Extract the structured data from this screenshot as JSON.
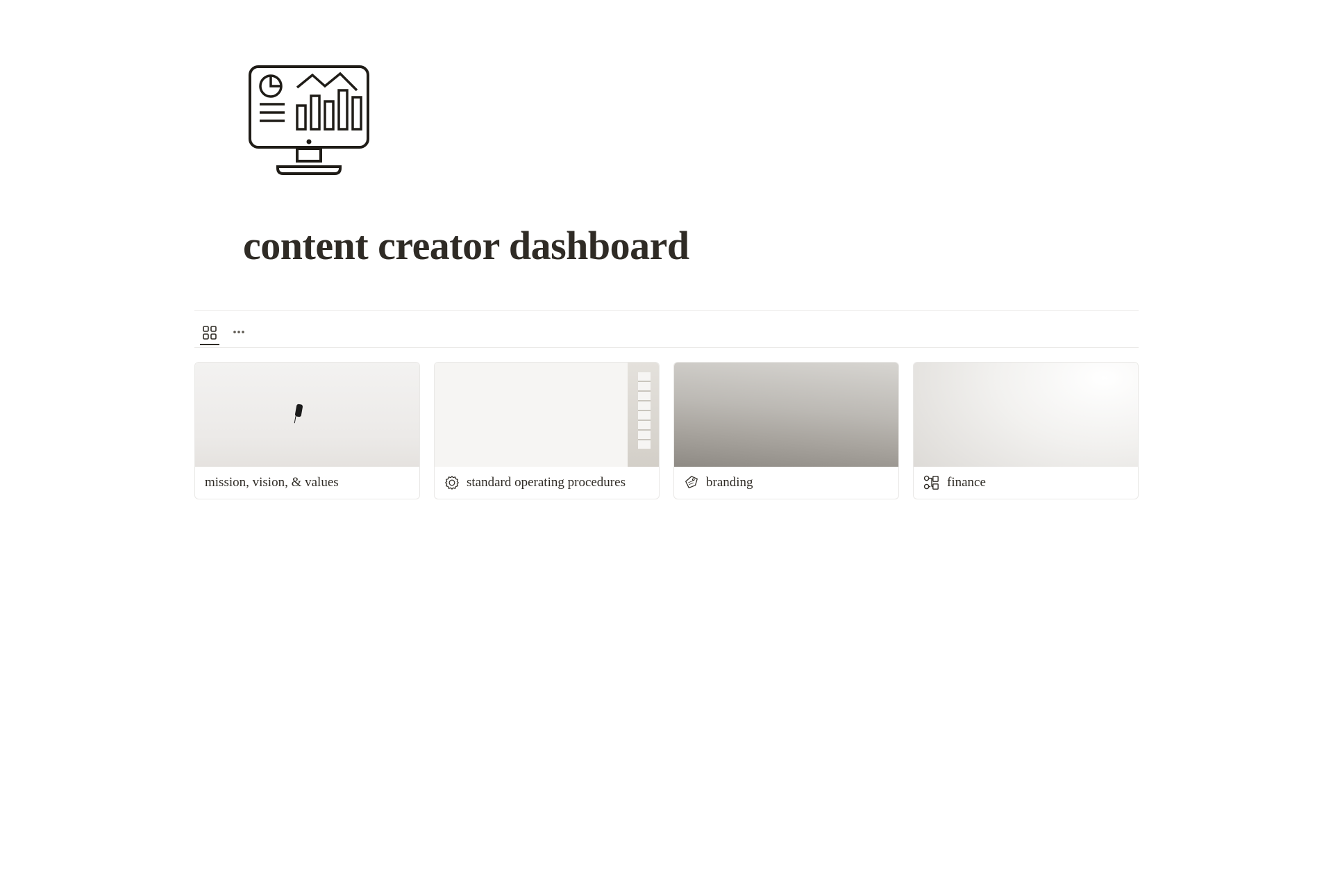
{
  "page": {
    "title": "content creator dashboard"
  },
  "views": {
    "gallery_icon": "gallery",
    "more_icon": "more"
  },
  "cards": [
    {
      "label": "mission, vision, & values",
      "icon": null
    },
    {
      "label": "standard operating procedures",
      "icon": "sop"
    },
    {
      "label": "branding",
      "icon": "brand-tag"
    },
    {
      "label": "finance",
      "icon": "finance"
    }
  ]
}
